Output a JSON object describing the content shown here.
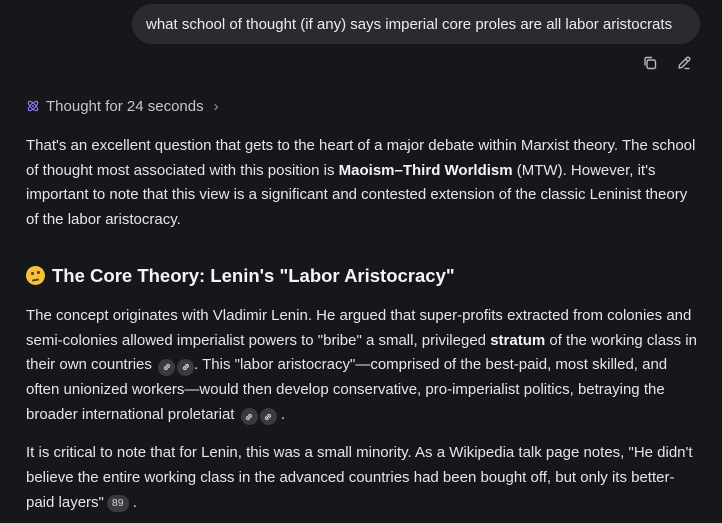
{
  "user_message": "what school of thought (if any) says imperial core proles are all labor aristocrats",
  "actions": {
    "copy": "copy-icon",
    "edit": "edit-icon"
  },
  "thought": {
    "label": "Thought for 24 seconds",
    "chevron": "›"
  },
  "answer": {
    "p1": {
      "a": "That's an excellent question that gets to the heart of a major debate within Marxist theory. The school of thought most associated with this position is ",
      "bold": "Maoism–Third Worldism",
      "b": " (MTW). However, it's important to note that this view is a significant and contested extension of the classic Leninist theory of the labor aristocracy."
    },
    "heading": "The Core Theory: Lenin's \"Labor Aristocracy\"",
    "p2": {
      "a": "The concept originates with Vladimir Lenin. He argued that super-profits extracted from colonies and semi-colonies allowed imperialist powers to \"bribe\" a small, privileged ",
      "bold": "stratum",
      "b": " of the working class in their own countries",
      "c": ". This \"labor aristocracy\"—comprised of the best-paid, most skilled, and often unionized workers—would then develop conservative, pro-imperialist politics, betraying the broader international proletariat",
      "d": "."
    },
    "p3": {
      "a": "It is critical to note that for Lenin, this was a small minority. As a Wikipedia talk page notes, \"He didn't believe the entire working class in the advanced countries had been bought off, but only its better-paid layers\"",
      "cite": "89",
      "b": "."
    }
  },
  "colors": {
    "background": "#16171a",
    "bubble": "#2a2b30",
    "citation": "#3a3b40",
    "thought_icon": "#8b7cf6"
  }
}
